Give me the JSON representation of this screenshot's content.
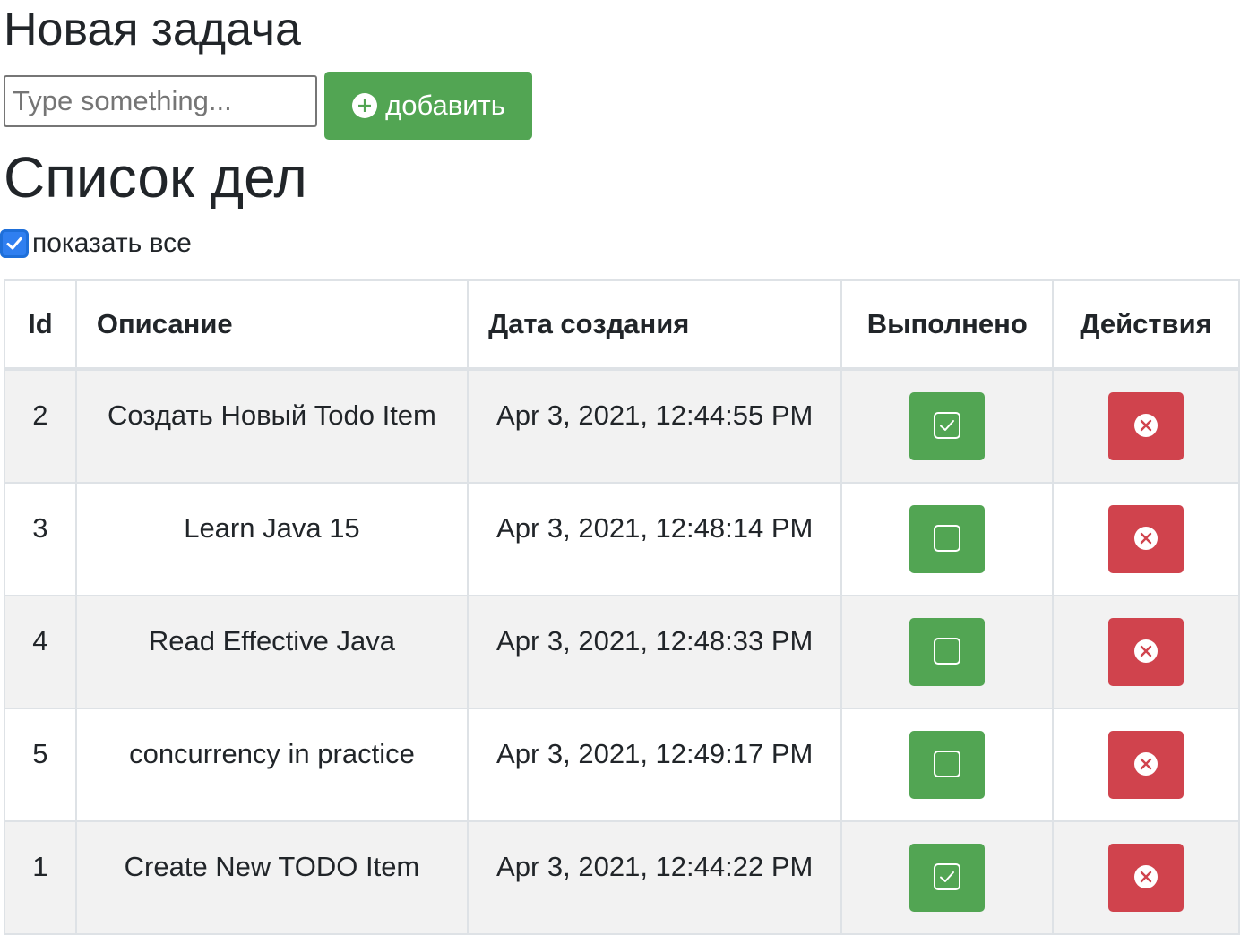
{
  "new_task": {
    "heading": "Новая задача",
    "input_placeholder": "Type something...",
    "input_value": "",
    "add_button_label": "добавить"
  },
  "todo_list": {
    "heading": "Список дел",
    "show_all_label": "показать все",
    "show_all_checked": true
  },
  "table": {
    "columns": [
      "Id",
      "Описание",
      "Дата создания",
      "Выполнено",
      "Действия"
    ],
    "rows": [
      {
        "id": "2",
        "description": "Создать Новый Todo Item",
        "created": "Apr 3, 2021, 12:44:55 PM",
        "done": true
      },
      {
        "id": "3",
        "description": "Learn Java 15",
        "created": "Apr 3, 2021, 12:48:14 PM",
        "done": false
      },
      {
        "id": "4",
        "description": "Read Effective Java",
        "created": "Apr 3, 2021, 12:48:33 PM",
        "done": false
      },
      {
        "id": "5",
        "description": "concurrency in practice",
        "created": "Apr 3, 2021, 12:49:17 PM",
        "done": false
      },
      {
        "id": "1",
        "description": "Create New TODO Item",
        "created": "Apr 3, 2021, 12:44:22 PM",
        "done": true
      }
    ]
  },
  "colors": {
    "success": "#52a553",
    "danger": "#d0434d",
    "checkbox_accent": "#2f7ff0",
    "row_stripe": "#f2f2f2"
  },
  "icons": {
    "add": "plus-circle-icon",
    "done_checked": "check-square-icon",
    "done_unchecked": "square-icon",
    "delete": "x-circle-icon",
    "show_all": "checkbox-checked-icon"
  }
}
